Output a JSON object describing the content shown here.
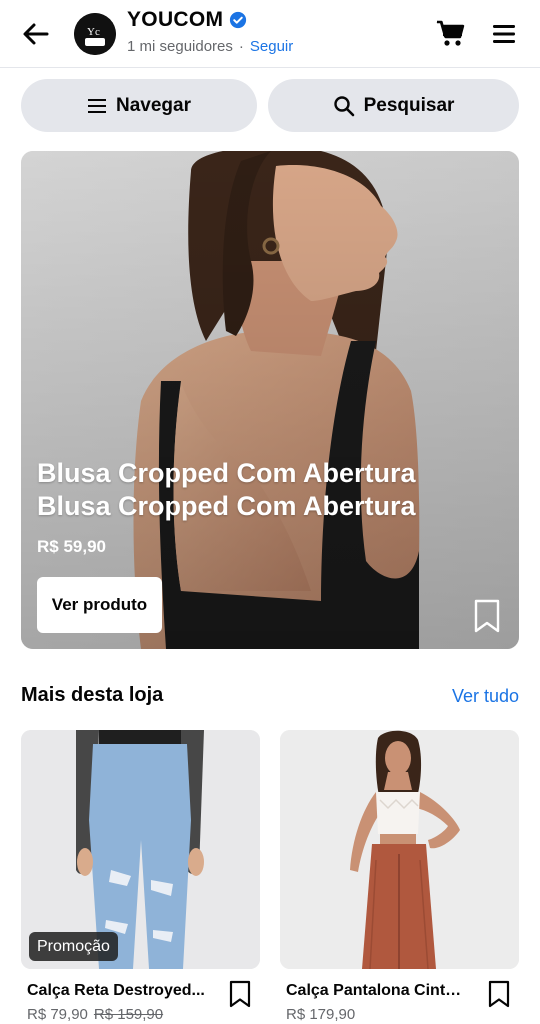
{
  "header": {
    "store_name": "YOUCOM",
    "followers": "1 mi seguidores",
    "separator": "·",
    "follow_label": "Seguir"
  },
  "actions": {
    "navigate_label": "Navegar",
    "search_label": "Pesquisar"
  },
  "hero": {
    "title": "Blusa Cropped Com Abertura Blusa Cropped Com Abertura",
    "price": "R$ 59,90",
    "button_label": "Ver produto"
  },
  "section": {
    "title": "Mais desta loja",
    "see_all_label": "Ver tudo"
  },
  "products": [
    {
      "name": "Calça Reta Destroyed...",
      "price": "R$ 79,90",
      "old_price": "R$ 159,90",
      "badge": "Promoção"
    },
    {
      "name": "Calça Pantalona Cintu...",
      "price": "R$ 179,90"
    }
  ],
  "icons": {
    "back": "arrow-left-icon",
    "verified": "verified-badge-icon",
    "cart": "cart-icon",
    "menu": "hamburger-menu-icon",
    "search": "search-icon",
    "bookmark": "bookmark-icon"
  },
  "colors": {
    "accent": "#1b74e4",
    "pill_bg": "#e4e6eb",
    "secondary_text": "#65676b"
  }
}
